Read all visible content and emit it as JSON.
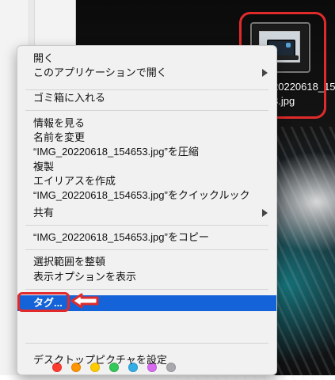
{
  "desktop": {
    "file_label_lines": [
      "20220618_15",
      "3.jpg"
    ],
    "callout_color": "#e12b2b"
  },
  "menu": {
    "items": {
      "open": "開く",
      "open_with": "このアプリケーションで開く",
      "move_to_trash": "ゴミ箱に入れる",
      "get_info": "情報を見る",
      "rename": "名前を変更",
      "compress": "“IMG_20220618_154653.jpg”を圧縮",
      "duplicate": "複製",
      "make_alias": "エイリアスを作成",
      "quick_look": "“IMG_20220618_154653.jpg”をクイックルック",
      "share": "共有",
      "copy": "“IMG_20220618_154653.jpg”をコピー",
      "clean_up_selection": "選択範囲を整頓",
      "show_view_options": "表示オプションを表示",
      "tags": "タグ...",
      "set_desktop_picture": "デスクトップピクチャを設定"
    },
    "tag_colors": [
      {
        "name": "red",
        "color": "#ff3b30"
      },
      {
        "name": "orange",
        "color": "#ff9500"
      },
      {
        "name": "yellow",
        "color": "#ffcc00"
      },
      {
        "name": "green",
        "color": "#34c759"
      },
      {
        "name": "blue",
        "color": "#32ade6"
      },
      {
        "name": "purple",
        "color": "#d66bf0"
      },
      {
        "name": "gray",
        "color": "#a9a9ad"
      }
    ],
    "highlight_color": "#1463d8"
  },
  "icons": {
    "submenu": "chevron-right-icon",
    "pointer": "arrow-left-icon"
  }
}
